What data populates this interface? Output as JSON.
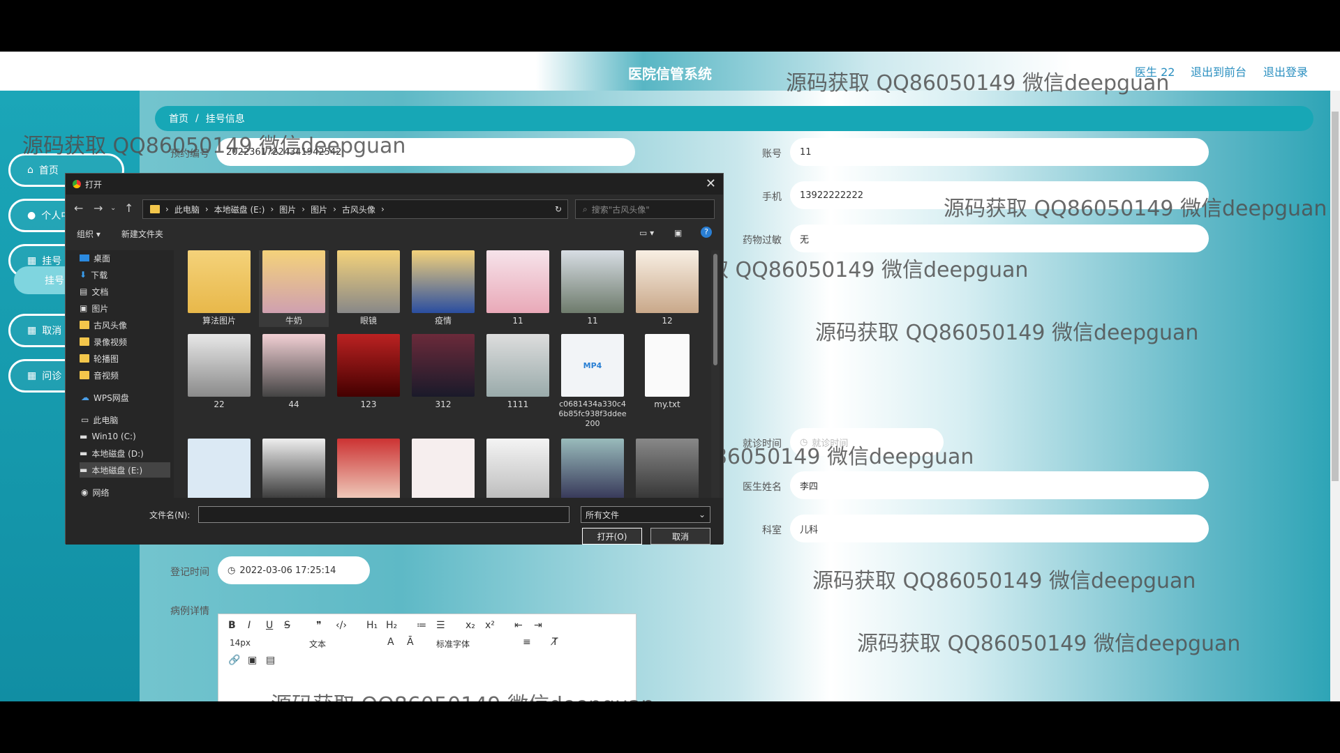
{
  "app": {
    "title": "医院信管系统"
  },
  "topbar": {
    "user": "医生 22",
    "to_front": "退出到前台",
    "logout": "退出登录"
  },
  "sidebar": {
    "items": [
      {
        "label": "首页"
      },
      {
        "label": "个人中心"
      },
      {
        "label": "挂号"
      },
      {
        "label": "取消"
      },
      {
        "label": "问诊"
      }
    ],
    "sub_item": "挂号"
  },
  "breadcrumb": {
    "home": "首页",
    "sep": "/",
    "current": "挂号信息"
  },
  "form": {
    "appointment_no": {
      "label": "预约编号",
      "value": "20223617224341942542"
    },
    "account": {
      "label": "账号",
      "value": "11"
    },
    "phone": {
      "label": "手机",
      "value": "13922222222"
    },
    "allergy": {
      "label": "药物过敏",
      "value": "无"
    },
    "visit_time": {
      "label": "就诊时间",
      "placeholder": "就诊时间"
    },
    "doctor_name": {
      "label": "医生姓名",
      "value": "李四"
    },
    "department": {
      "label": "科室",
      "value": "儿科"
    },
    "register_time": {
      "label": "登记时间",
      "value": "2022-03-06 17:25:14"
    },
    "case_detail": {
      "label": "病例详情"
    }
  },
  "editor": {
    "font_size": "14px",
    "text_type": "文本",
    "font_family": "标准字体"
  },
  "dialog": {
    "title": "打开",
    "path": [
      "此电脑",
      "本地磁盘 (E:)",
      "图片",
      "图片",
      "古风头像"
    ],
    "search_placeholder": "搜索\"古风头像\"",
    "organize": "组织 ▾",
    "new_folder": "新建文件夹",
    "tree": [
      "桌面",
      "下载",
      "文档",
      "图片",
      "古风头像",
      "录像视频",
      "轮播图",
      "音视频",
      "WPS网盘",
      "此电脑",
      "Win10 (C:)",
      "本地磁盘 (D:)",
      "本地磁盘 (E:)",
      "网络"
    ],
    "files_row1": [
      "算法图片",
      "牛奶",
      "眼镜",
      "疫情",
      "11",
      "11",
      "12"
    ],
    "files_row2": [
      "22",
      "44",
      "123",
      "312",
      "1111",
      "c0681434a330c46b85fc938f3ddee200",
      "my.txt"
    ],
    "filename_label": "文件名(N):",
    "filetype": "所有文件",
    "open_btn": "打开(O)",
    "cancel_btn": "取消"
  },
  "watermark": "源码获取 QQ86050149 微信deepguan"
}
